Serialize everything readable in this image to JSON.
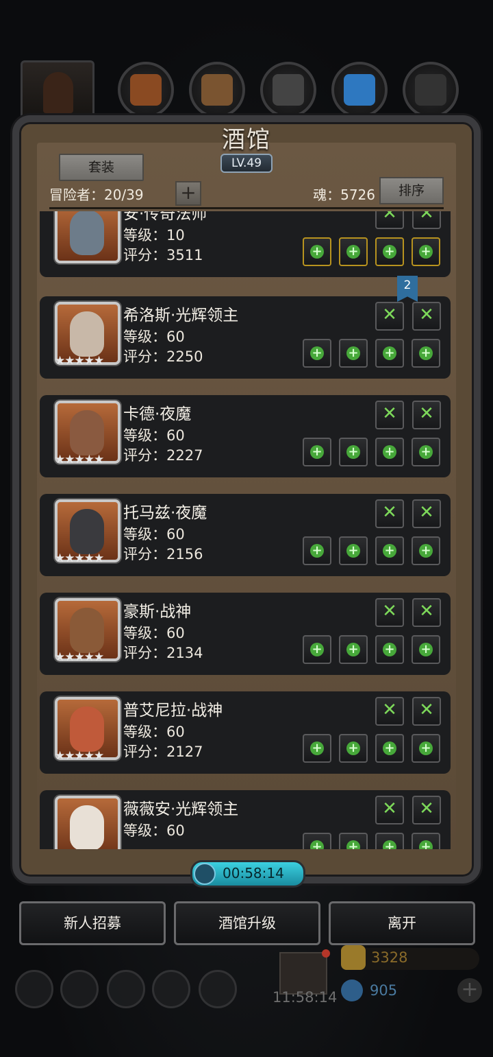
{
  "top_resources": [
    {
      "icon": "hooded-hero-icon",
      "color": "#3a2418"
    },
    {
      "icon": "meat-icon",
      "color": "#8a4a22"
    },
    {
      "icon": "wood-planks-icon",
      "color": "#7a5430"
    },
    {
      "icon": "iron-bars-icon",
      "color": "#444"
    },
    {
      "icon": "blue-crystal-icon",
      "color": "#2e78c0"
    },
    {
      "icon": "dark-iron-icon",
      "color": "#333"
    }
  ],
  "tavern": {
    "title": "酒馆",
    "level": "LV.49",
    "suit_button": "套装",
    "adventurers_label": "冒险者：20/39",
    "soul_label": "魂：5726",
    "sort_button": "排序"
  },
  "heroes": [
    {
      "name": "安·传奇法师",
      "level": "等级：10",
      "score": "评分：3511",
      "stars": "",
      "face": "#6d7c8a",
      "top_slots": [
        "meat-item-icon",
        "blade-item-icon"
      ],
      "bottom_slots": [
        "staff-item-icon",
        "armor-item-icon",
        "ring-item-icon",
        "ring-item-icon"
      ],
      "bottom_gold": true
    },
    {
      "name": "希洛斯·光辉领主",
      "level": "等级：60",
      "score": "评分：2250",
      "stars": "★★★★★",
      "face": "#c8b8a8",
      "top_slots": [
        "empty-slot-icon",
        "empty-slot-icon"
      ],
      "bottom_slots": [
        "add-slot-icon",
        "add-slot-icon",
        "add-slot-icon",
        "add-slot-icon"
      ],
      "bottom_gold": false
    },
    {
      "name": "卡德·夜魔",
      "level": "等级：60",
      "score": "评分：2227",
      "stars": "★★★★★",
      "face": "#8a5a40",
      "top_slots": [
        "empty-slot-icon",
        "empty-slot-icon"
      ],
      "bottom_slots": [
        "add-slot-icon",
        "add-slot-icon",
        "add-slot-icon",
        "add-slot-icon"
      ],
      "bottom_gold": false
    },
    {
      "name": "托马兹·夜魔",
      "level": "等级：60",
      "score": "评分：2156",
      "stars": "★★★★★",
      "face": "#3a3a3e",
      "top_slots": [
        "empty-slot-icon",
        "empty-slot-icon"
      ],
      "bottom_slots": [
        "add-slot-icon",
        "add-slot-icon",
        "add-slot-icon",
        "add-slot-icon"
      ],
      "bottom_gold": false
    },
    {
      "name": "豪斯·战神",
      "level": "等级：60",
      "score": "评分：2134",
      "stars": "★★★★★",
      "face": "#8a5a38",
      "top_slots": [
        "empty-slot-icon",
        "empty-slot-icon"
      ],
      "bottom_slots": [
        "add-slot-icon",
        "add-slot-icon",
        "add-slot-icon",
        "add-slot-icon"
      ],
      "bottom_gold": false
    },
    {
      "name": "普艾尼拉·战神",
      "level": "等级：60",
      "score": "评分：2127",
      "stars": "★★★★★",
      "face": "#c05a3a",
      "top_slots": [
        "empty-slot-icon",
        "empty-slot-icon"
      ],
      "bottom_slots": [
        "add-slot-icon",
        "add-slot-icon",
        "add-slot-icon",
        "add-slot-icon"
      ],
      "bottom_gold": false
    },
    {
      "name": "薇薇安·光辉领主",
      "level": "等级：60",
      "score": "",
      "stars": "",
      "face": "#e8e0d6",
      "top_slots": [
        "empty-slot-icon",
        "empty-slot-icon"
      ],
      "bottom_slots": [
        "add-slot-icon",
        "add-slot-icon",
        "add-slot-icon",
        "add-slot-icon"
      ],
      "bottom_gold": false
    }
  ],
  "bookmark": "2",
  "timer": "00:58:14",
  "buttons": {
    "recruit": "新人招募",
    "upgrade": "酒馆升级",
    "leave": "离开"
  },
  "hud": {
    "gift_time": "11:58:14",
    "gold": "3328",
    "gems": "905"
  }
}
